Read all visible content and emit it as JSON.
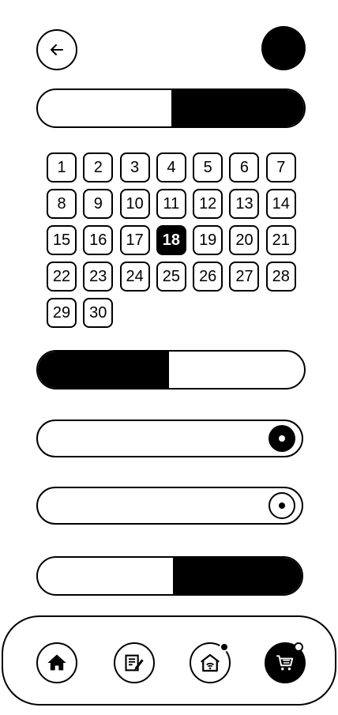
{
  "header": {
    "back_icon": "arrow-left-icon",
    "avatar": "avatar"
  },
  "toggle_top": {
    "fill_fraction": 0.5,
    "fill_side": "right"
  },
  "calendar": {
    "days": [
      "1",
      "2",
      "3",
      "4",
      "5",
      "6",
      "7",
      "8",
      "9",
      "10",
      "11",
      "12",
      "13",
      "14",
      "15",
      "16",
      "17",
      "18",
      "19",
      "20",
      "21",
      "22",
      "23",
      "24",
      "25",
      "26",
      "27",
      "28",
      "29",
      "30"
    ],
    "selected_day": "18"
  },
  "toggle_middle": {
    "fill_fraction": 0.5,
    "fill_side": "left"
  },
  "radio_input_1": {
    "radio_state": "selected-filled"
  },
  "radio_input_2": {
    "radio_state": "selected-outline"
  },
  "toggle_bottom": {
    "fill_fraction": 0.5,
    "fill_side": "right"
  },
  "bottom_nav": {
    "items": [
      {
        "icon": "home-icon",
        "active": false,
        "badge": false
      },
      {
        "icon": "edit-note-icon",
        "active": false,
        "badge": false
      },
      {
        "icon": "smart-home-wifi-icon",
        "active": false,
        "badge": true
      },
      {
        "icon": "cart-icon",
        "active": true,
        "badge": true
      }
    ]
  }
}
